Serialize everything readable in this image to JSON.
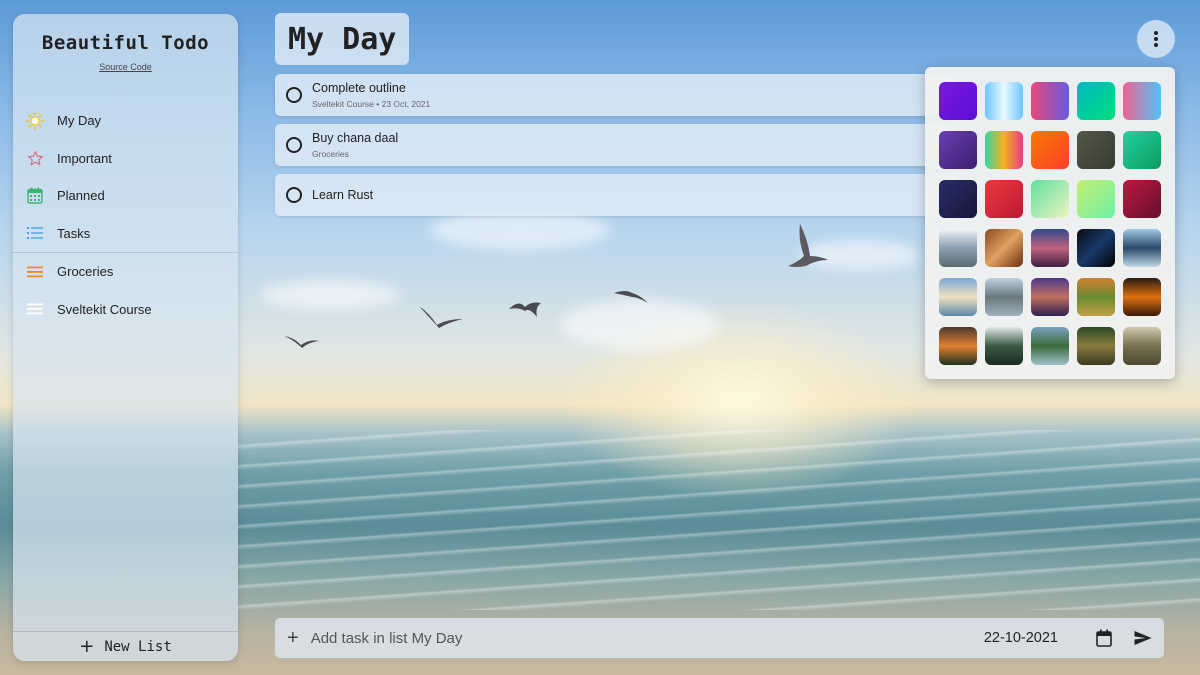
{
  "app": {
    "title": "Beautiful Todo",
    "source_link": "Source Code"
  },
  "sidebar": {
    "items": [
      {
        "label": "My Day",
        "icon": "sun-icon",
        "color": "#f5c400"
      },
      {
        "label": "Important",
        "icon": "star-icon",
        "color": "#e0667a"
      },
      {
        "label": "Planned",
        "icon": "calendar-icon",
        "color": "#3cb371"
      },
      {
        "label": "Tasks",
        "icon": "list-icon",
        "color": "#4aa3df"
      }
    ],
    "lists": [
      {
        "label": "Groceries",
        "icon": "list-lines-icon",
        "color": "#f08a24"
      },
      {
        "label": "Sveltekit Course",
        "icon": "list-lines-icon",
        "color": "#ffffff"
      }
    ],
    "new_list_label": "New List"
  },
  "main": {
    "title": "My Day",
    "tasks": [
      {
        "title": "Complete outline",
        "meta": "Sveltekit Course • 23 Oct, 2021"
      },
      {
        "title": "Buy chana daal",
        "meta": "Groceries"
      },
      {
        "title": "Learn Rust",
        "meta": ""
      }
    ]
  },
  "add_task": {
    "placeholder": "Add task in list My Day",
    "date": "22-10-2021"
  },
  "palette": {
    "swatches": [
      "linear-gradient(135deg,#7a18e6,#5b0fd0)",
      "linear-gradient(90deg,#6ec6ff,#e8f8ff,#6ec6ff)",
      "linear-gradient(90deg,#e8487a,#6a5ae0)",
      "linear-gradient(135deg,#00b7c2,#00e07a)",
      "linear-gradient(90deg,#f06292,#4fc3f7)",
      "linear-gradient(135deg,#6a3fb0,#3a1f70)",
      "linear-gradient(90deg,#32d6a0,#f5b020,#e83a8a)",
      "linear-gradient(135deg,#f57c00,#ff3d2e)",
      "linear-gradient(135deg,#55564a,#3a3b30)",
      "linear-gradient(135deg,#1dd3a0,#0f9b5f)",
      "linear-gradient(135deg,#2a2d66,#14163a)",
      "linear-gradient(135deg,#e83a3a,#c01838)",
      "linear-gradient(135deg,#5ee0a0,#f0f3c0)",
      "linear-gradient(135deg,#c0f070,#70f0a8)",
      "linear-gradient(135deg,#c0183c,#601030)",
      "linear-gradient(180deg,#f0f3f5,#8aa0b0,#5a6a70)",
      "linear-gradient(135deg,#8a4a20,#e0a060,#6a3010)",
      "linear-gradient(180deg,#304a8a,#c06080,#402040)",
      "linear-gradient(135deg,#080a10,#1a3a6a,#000)",
      "linear-gradient(180deg,#a0c8e8,#2a4a6a,#c0d8e8)",
      "linear-gradient(180deg,#7aa8d8,#f0e0c0,#5a8aa8)",
      "linear-gradient(180deg,#c0d0e0,#6a7a80,#a0b0b8)",
      "linear-gradient(180deg,#4a3a8a,#c07060,#2a2050)",
      "linear-gradient(180deg,#d08030,#6a8a30,#c0a040)",
      "linear-gradient(180deg,#2a1a10,#e07010,#3a1a08)",
      "linear-gradient(180deg,#4a3a30,#e08030,#203020)",
      "linear-gradient(180deg,#e0e8e8,#3a5a40,#1a2a20)",
      "linear-gradient(180deg,#7aa0c0,#3a6a3a,#a0c0c8)",
      "linear-gradient(180deg,#2a4a20,#8a7a40,#3a3a20)",
      "linear-gradient(180deg,#d0c8b0,#7a7050,#4a4a30)"
    ]
  }
}
